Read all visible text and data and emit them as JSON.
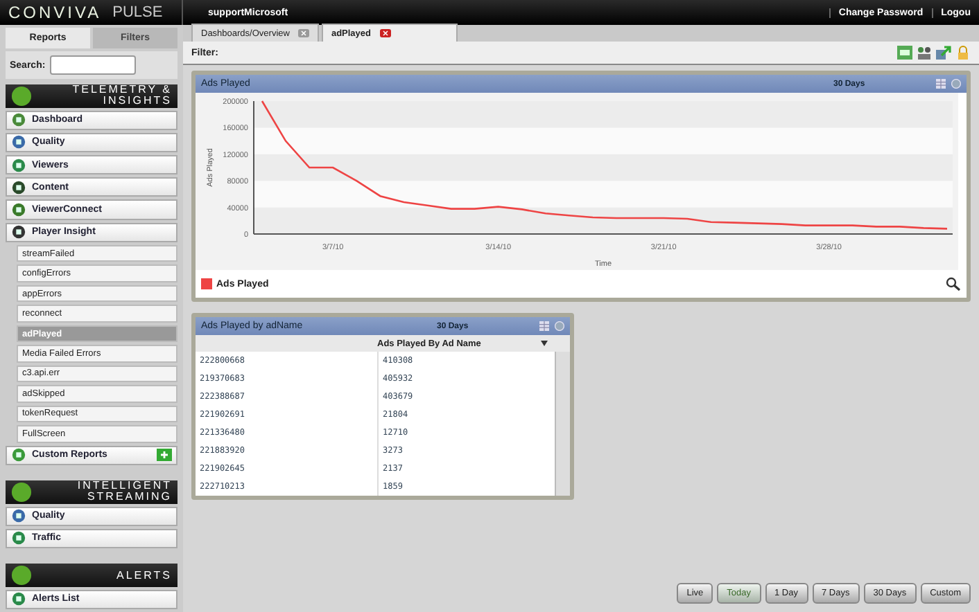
{
  "header": {
    "logo": "CONVIVA",
    "product": "PULSE",
    "account": "supportMicrosoft",
    "links": [
      "Change Password",
      "Logou"
    ]
  },
  "sidebar": {
    "tabs": [
      {
        "label": "Reports",
        "selected": true
      },
      {
        "label": "Filters",
        "selected": false
      }
    ],
    "search": {
      "label": "Search:"
    },
    "sections": [
      {
        "title_lines": [
          "TELEMETRY &",
          "INSIGHTS"
        ],
        "items": [
          {
            "label": "Dashboard",
            "has_add": false
          },
          {
            "label": "Quality",
            "has_add": false
          },
          {
            "label": "Viewers",
            "has_add": false
          },
          {
            "label": "Content",
            "has_add": false
          },
          {
            "label": "ViewerConnect",
            "has_add": false
          },
          {
            "label": "Player Insight",
            "has_add": false,
            "children": [
              {
                "label": "streamFailed",
                "selected": false
              },
              {
                "label": "configErrors",
                "selected": false
              },
              {
                "label": "appErrors",
                "selected": false
              },
              {
                "label": "reconnect",
                "selected": false
              },
              {
                "label": "adPlayed",
                "selected": true
              },
              {
                "label": "Media Failed Errors",
                "selected": false
              },
              {
                "label": "c3.api.err",
                "selected": false
              },
              {
                "label": "adSkipped",
                "selected": false
              },
              {
                "label": "tokenRequest",
                "selected": false
              },
              {
                "label": "FullScreen",
                "selected": false
              }
            ]
          },
          {
            "label": "Custom Reports",
            "has_add": true
          }
        ]
      },
      {
        "title_lines": [
          "INTELLIGENT",
          "STREAMING"
        ],
        "items": [
          {
            "label": "Quality",
            "has_add": false
          },
          {
            "label": "Traffic",
            "has_add": false
          }
        ]
      },
      {
        "title_lines": [
          "ALERTS"
        ],
        "items": [
          {
            "label": "Alerts List",
            "has_add": false
          }
        ]
      }
    ]
  },
  "tabs": [
    {
      "label": "Dashboards/Overview",
      "selected": false
    },
    {
      "label": "adPlayed",
      "selected": true
    }
  ],
  "filter": {
    "label": "Filter:"
  },
  "chart_panel": {
    "title": "Ads Played",
    "range": "30 Days",
    "chart_data": {
      "type": "line",
      "xlabel": "Time",
      "ylabel": "Ads Played",
      "ylim": [
        0,
        200000
      ],
      "yticks": [
        0,
        40000,
        80000,
        120000,
        160000,
        200000
      ],
      "categories": [
        null,
        null,
        null,
        "3/7/10",
        null,
        null,
        null,
        null,
        null,
        null,
        "3/14/10",
        null,
        null,
        null,
        null,
        null,
        null,
        "3/21/10",
        null,
        null,
        null,
        null,
        null,
        null,
        "3/28/10",
        null,
        null,
        null,
        null,
        null
      ],
      "series": [
        {
          "name": "Ads Played",
          "color": "#ee4444",
          "values": [
            200000,
            140000,
            100000,
            100000,
            80000,
            57000,
            48000,
            43000,
            38000,
            38000,
            41000,
            37000,
            31000,
            28000,
            25000,
            24000,
            24000,
            24000,
            23000,
            18000,
            17000,
            16000,
            15000,
            13000,
            13000,
            13000,
            11000,
            11000,
            9000,
            8000
          ]
        }
      ]
    }
  },
  "table_panel": {
    "title": "Ads Played by adName",
    "range": "30 Days",
    "column_2_heading": "Ads Played By Ad Name",
    "rows": [
      [
        "222800668",
        "410308"
      ],
      [
        "219370683",
        "405932"
      ],
      [
        "222388687",
        "403679"
      ],
      [
        "221902691",
        "21804"
      ],
      [
        "221336480",
        "12710"
      ],
      [
        "221883920",
        "3273"
      ],
      [
        "221902645",
        "2137"
      ],
      [
        "222710213",
        "1859"
      ]
    ]
  },
  "range_buttons": [
    {
      "label": "Live",
      "selected": false
    },
    {
      "label": "Today",
      "selected": true
    },
    {
      "label": "1 Day",
      "selected": false
    },
    {
      "label": "7 Days",
      "selected": false
    },
    {
      "label": "30 Days",
      "selected": false
    },
    {
      "label": "Custom",
      "selected": false
    }
  ]
}
